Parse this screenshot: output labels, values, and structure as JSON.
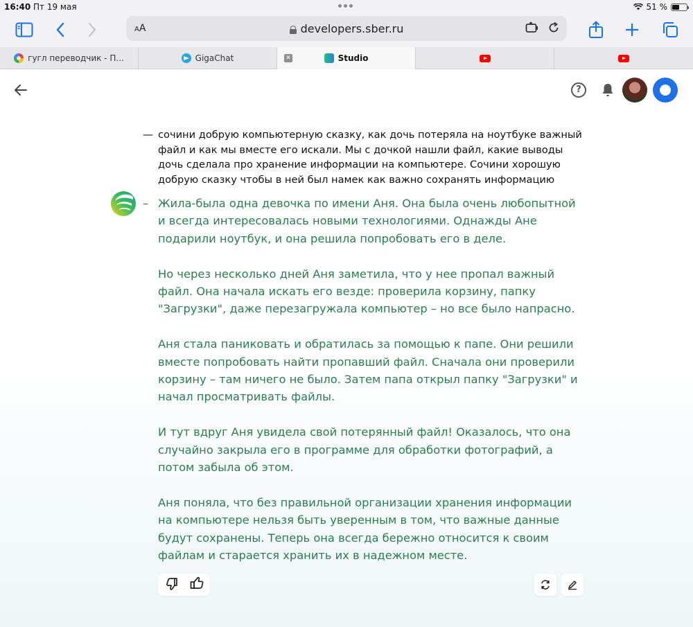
{
  "status_bar": {
    "time": "16:40",
    "date": "Пт 19 мая",
    "battery": "51 %",
    "battery_level": 0.51
  },
  "toolbar": {
    "text_size_label": "AA",
    "url": "developers.sber.ru"
  },
  "tabs": [
    {
      "label": "гугл переводчик - П...",
      "icon": "google-icon"
    },
    {
      "label": "GigaChat",
      "icon": "telegram-icon"
    },
    {
      "label": "Studio",
      "icon": "studio-icon",
      "active": true
    },
    {
      "label": "",
      "icon": "youtube-icon"
    },
    {
      "label": "",
      "icon": "youtube-icon"
    }
  ],
  "header": {
    "help_label": "?"
  },
  "chat": {
    "dash": "—",
    "bot_dash": "–",
    "user_message": "сочини добрую компьютерную сказку, как дочь потеряла на ноутбуке важный файл и как мы вместе его искали. Мы с дочкой нашли файл, какие выводы дочь сделала про хранение информации на компьютере. Сочини хорошую добрую сказку чтобы в ней был намек как важно сохранять информацию",
    "bot_paragraphs": [
      "Жила-была одна девочка по имени Аня. Она была очень любопытной и всегда интересовалась новыми технологиями. Однажды Ане подарили ноутбук, и она решила попробовать его в деле.",
      "Но через несколько дней Аня заметила, что у нее пропал важный файл. Она начала искать его везде: проверила корзину, папку \"Загрузки\", даже перезагружала компьютер – но все было напрасно.",
      "Аня стала паниковать и обратилась за помощью к папе. Они решили вместе попробовать найти пропавший файл. Сначала они проверили корзину – там ничего не было. Затем папа открыл папку \"Загрузки\" и начал просматривать файлы.",
      "И тут вдруг Аня увидела свой потерянный файл! Оказалось, что она случайно закрыла его в программе для обработки фотографий, а потом забыла об этом.",
      "Аня поняла, что без правильной организации хранения информации на компьютере нельзя быть уверенным в том, что важные данные будут сохранены. Теперь она всегда бережно относится к своим файлам и старается хранить их в надежном месте."
    ]
  },
  "colors": {
    "bot_text": "#2b7d4f",
    "accent": "#1f6feb",
    "safari_blue": "#1a73e8"
  }
}
